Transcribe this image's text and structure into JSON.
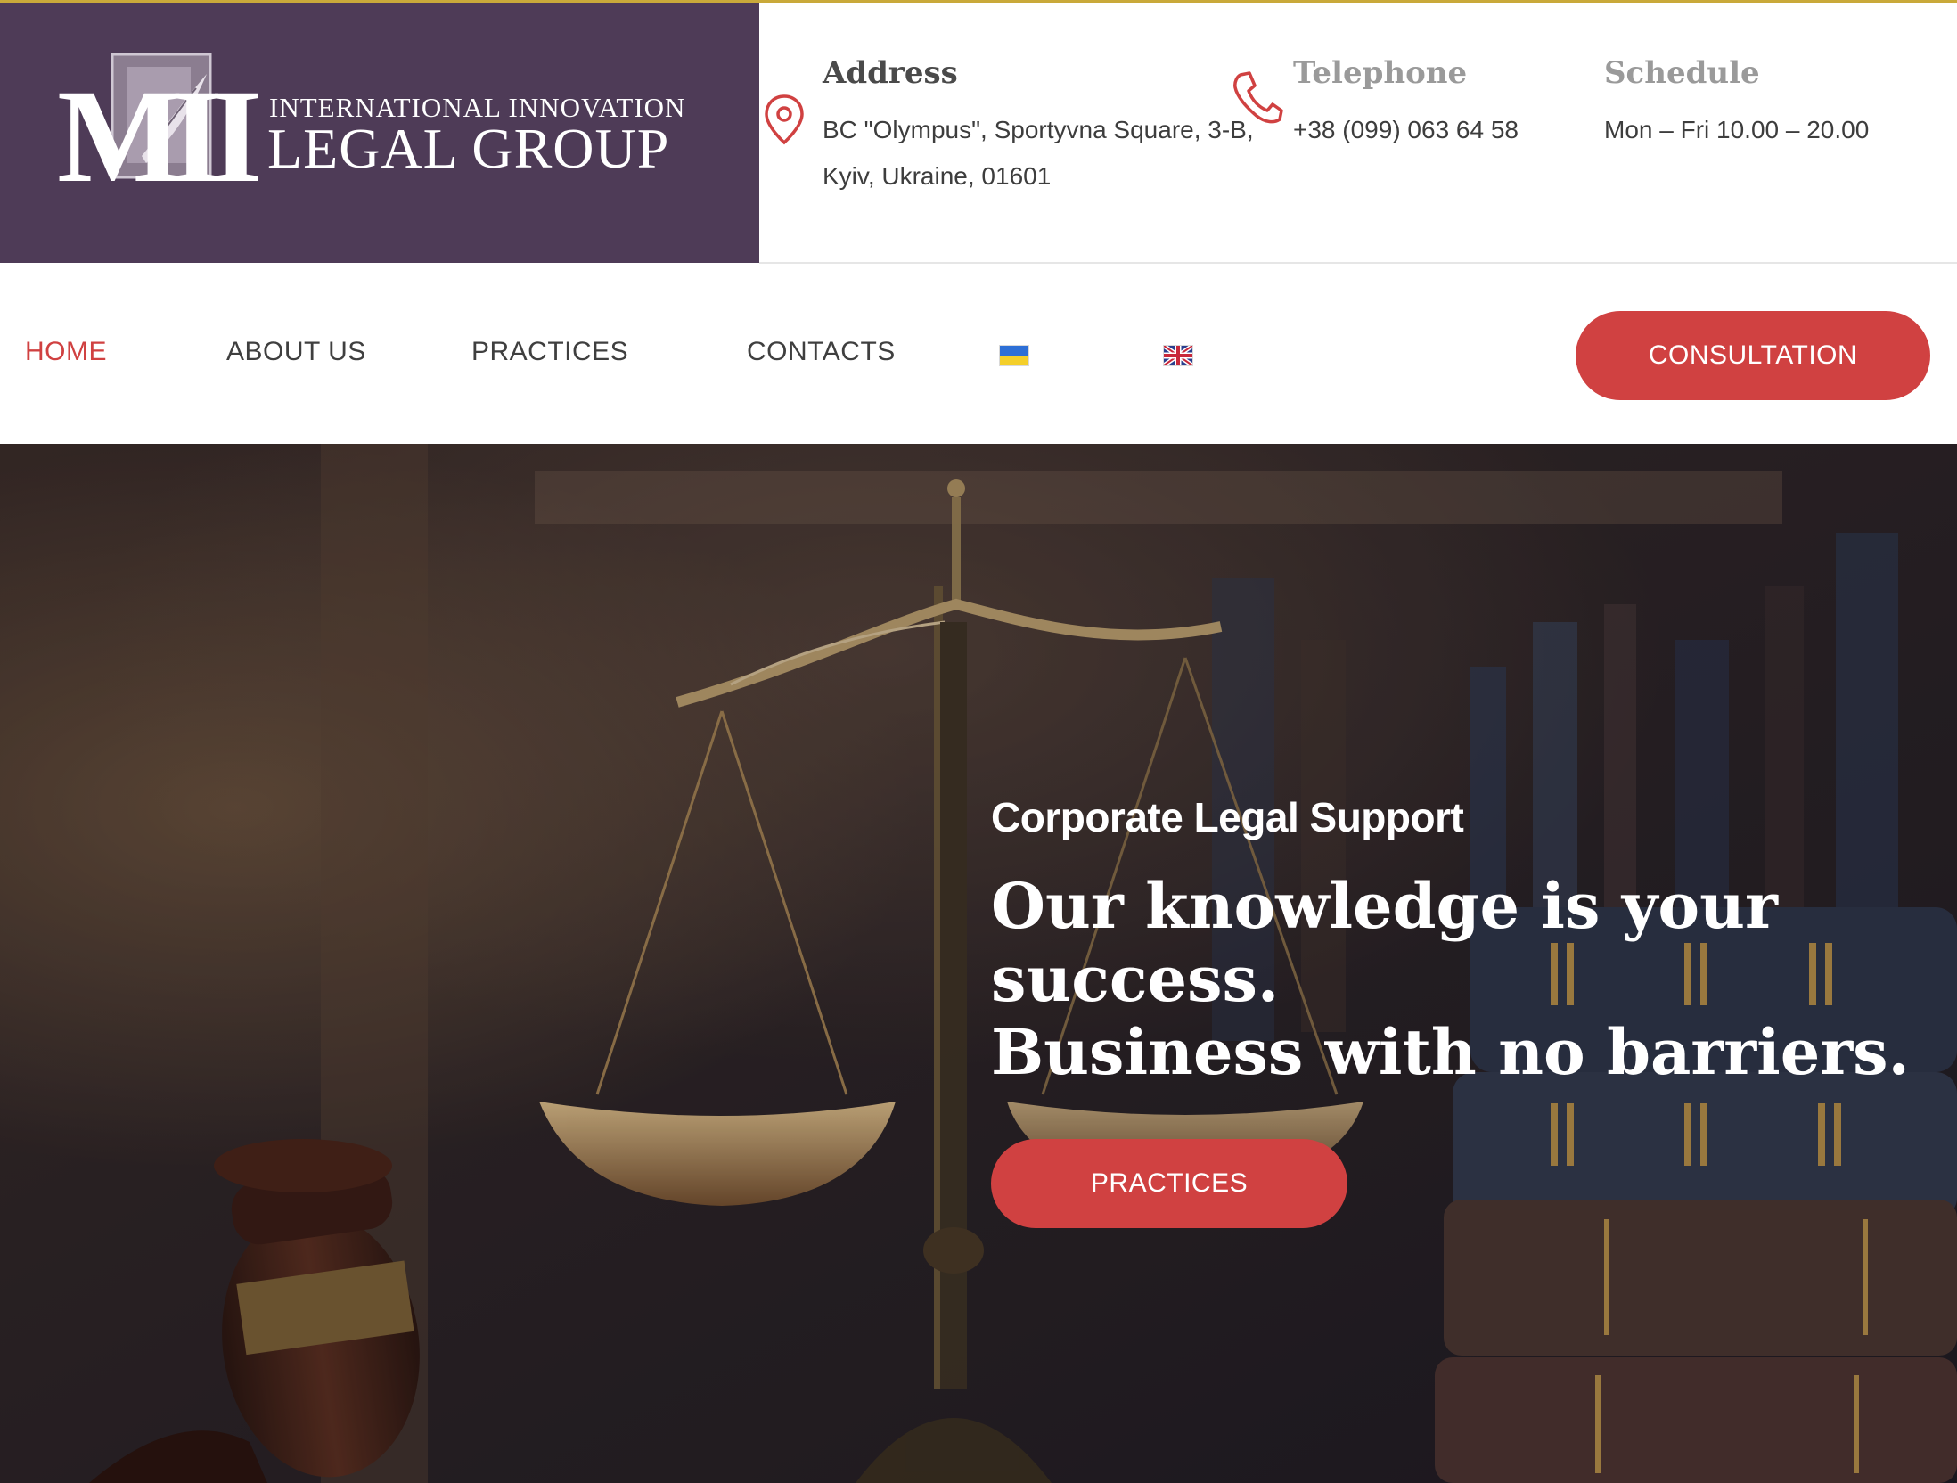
{
  "brand": {
    "logo_monogram": "MII",
    "line1": "INTERNATIONAL  INNOVATION",
    "line2": "LEGAL GROUP"
  },
  "contact": {
    "address": {
      "title": "Address",
      "line1": "BC \"Olympus\", Sportyvna Square, 3-B,",
      "line2": "Kyiv, Ukraine, 01601",
      "icon": "map-pin-icon"
    },
    "telephone": {
      "title": "Telephone",
      "value": "+38 (099) 063 64 58",
      "icon": "phone-icon"
    },
    "schedule": {
      "title": "Schedule",
      "value": "Mon – Fri 10.00 – 20.00"
    }
  },
  "nav": {
    "home": "HOME",
    "about": "ABOUT US",
    "practices": "PRACTICES",
    "contacts": "CONTACTS",
    "languages": [
      "ukrainian-flag-icon",
      "uk-flag-icon"
    ],
    "cta": "CONSULTATION"
  },
  "hero": {
    "kicker": "Corporate Legal Support",
    "headline_line1": "Our knowledge is your",
    "headline_line2": "success.",
    "headline_line3": "Business with no barriers.",
    "button": "PRACTICES"
  },
  "colors": {
    "brand_purple": "#4e3b57",
    "accent_red": "#d04141",
    "gold_line": "#c9a93a"
  }
}
